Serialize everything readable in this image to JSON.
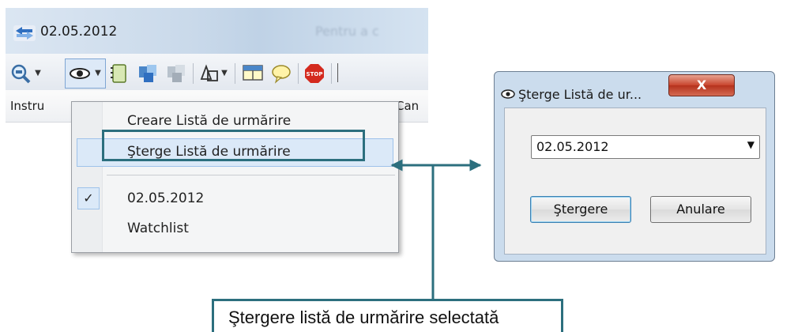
{
  "app": {
    "title": "02.05.2012",
    "title_faded": "Pentru a c",
    "columns": [
      "Instru",
      "Can"
    ]
  },
  "toolbar": {
    "icons": [
      "search-zoom-icon",
      "eye-icon",
      "notebook-icon",
      "cards-icon",
      "cards-disabled-icon",
      "shapes-icon",
      "grid-icon",
      "speech-bubble-icon",
      "stop-icon"
    ],
    "stop_text": "STOP"
  },
  "menu": {
    "items": [
      {
        "label": "Creare Listă de urmărire",
        "checked": false
      },
      {
        "label": "Şterge Listă de urmărire",
        "checked": false,
        "highlighted": true
      },
      {
        "label": "02.05.2012",
        "checked": true
      },
      {
        "label": "Watchlist",
        "checked": false
      }
    ],
    "check_glyph": "✓"
  },
  "dialog": {
    "title": "Şterge Listă de ur...",
    "close_label": "X",
    "selected_list": "02.05.2012",
    "delete_label": "Ştergere",
    "cancel_label": "Anulare"
  },
  "callout": {
    "text": "Ştergere listă de urmărire selectată",
    "color": "#2c6f7e"
  }
}
